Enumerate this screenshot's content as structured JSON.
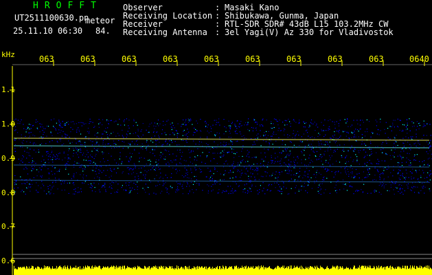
{
  "header": {
    "brand": "HROFFT",
    "filename": "UT2511100630.pn",
    "tag": "meteor",
    "datetime": "25.11.10 06:30",
    "count": "84.",
    "info": [
      {
        "key": "Observer",
        "value": "Masaki Kano"
      },
      {
        "key": "Receiving Location",
        "value": "Shibukawa, Gunma, Japan"
      },
      {
        "key": "Receiver",
        "value": "RTL-SDR SDR# 43dB L15 103.2MHz CW"
      },
      {
        "key": "Receiving Antenna",
        "value": "3el Yagi(V) Az 330 for Vladivostok"
      }
    ]
  },
  "axes": {
    "unit": "kHz",
    "time_ticks": [
      "063",
      "063",
      "063",
      "063",
      "063",
      "063",
      "063",
      "063",
      "063",
      "0640"
    ],
    "freq_ticks": [
      "1.1",
      "1.0",
      "0.9",
      "0.8",
      "0.7",
      "0.6"
    ]
  },
  "colors": {
    "accent_green": "#00ff00",
    "axis_yellow": "#ffff00",
    "noise_blue": "#0000ff",
    "background": "#000000"
  }
}
